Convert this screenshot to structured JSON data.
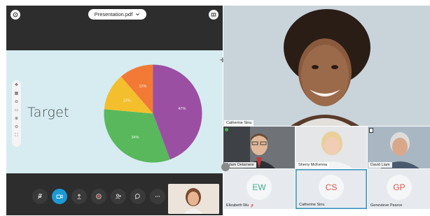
{
  "share": {
    "file_name": "Presentation.pdf",
    "slide_title": "Target",
    "zoom_tools": [
      "✥",
      "▦",
      "⊖",
      "▭",
      "⊕",
      "⊖",
      "⛶"
    ]
  },
  "chart_data": {
    "type": "pie",
    "values": [
      47,
      34,
      13,
      12
    ],
    "labels": [
      "47%",
      "34%",
      "13%",
      "12%"
    ],
    "colors": [
      "#9b4fa3",
      "#58b85b",
      "#f3bf2c",
      "#f27a36"
    ]
  },
  "controls": [
    {
      "name": "mute-button",
      "icon": "mic-off-icon"
    },
    {
      "name": "camera-button",
      "icon": "camera-icon",
      "active": true
    },
    {
      "name": "share-button",
      "icon": "upload-icon"
    },
    {
      "name": "record-button",
      "icon": "record-icon"
    },
    {
      "name": "participants-button",
      "icon": "person-add-icon"
    },
    {
      "name": "chat-button",
      "icon": "chat-icon"
    },
    {
      "name": "more-button",
      "icon": "more-icon"
    }
  ],
  "participants": {
    "main_speaker": "Catherine Sinu",
    "row1": [
      "Adam Delamere",
      "Sherry McKenna",
      "David Liam"
    ],
    "row2": [
      {
        "initials": "EW",
        "name": "Elizabeth Wu",
        "color": "#3fae8c",
        "bg": "#e6eaee",
        "circle": "#f4f6f7"
      },
      {
        "initials": "CS",
        "name": "Catherine Sinu",
        "color": "#e5534b",
        "bg": "#e6eaee",
        "circle": "#f4f6f7"
      },
      {
        "initials": "GP",
        "name": "Genevieve Pearce",
        "color": "#e5534b",
        "bg": "#e6eaee",
        "circle": "#f4f6f7"
      }
    ]
  }
}
